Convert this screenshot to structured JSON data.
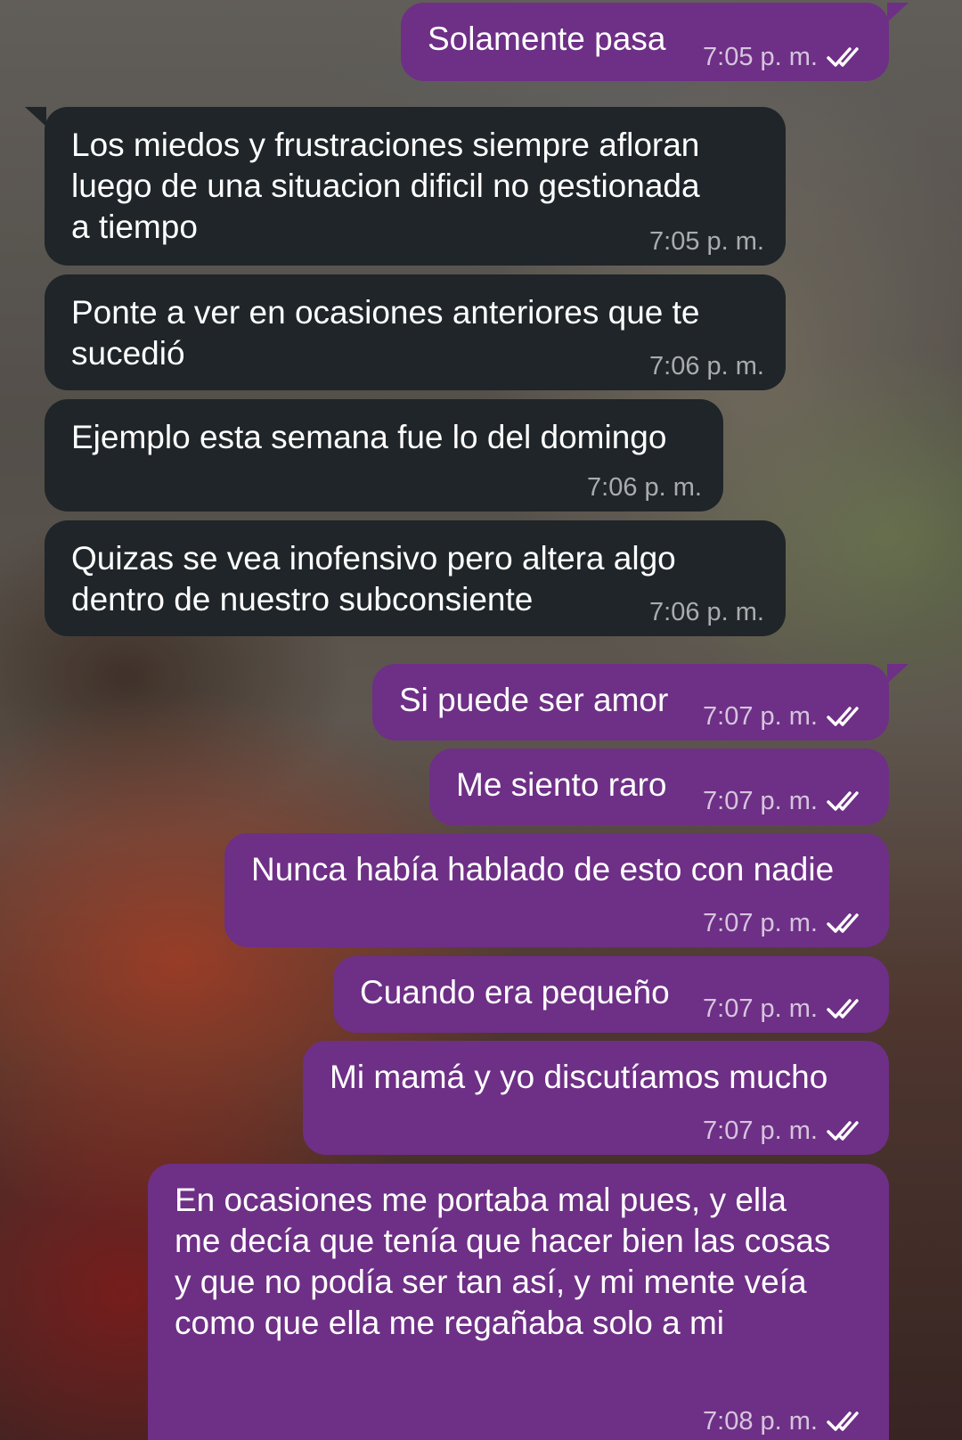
{
  "messages": [
    {
      "direction": "out",
      "text": "Solamente pasa",
      "time": "7:05 p. m.",
      "status_icon": "double-check-icon"
    },
    {
      "direction": "in",
      "text": "Los miedos y frustraciones siempre afloran\nluego de una situacion dificil no gestionada\na tiempo",
      "time": "7:05 p. m."
    },
    {
      "direction": "in",
      "text": "Ponte a ver en ocasiones anteriores que te\nsucedió",
      "time": "7:06 p. m."
    },
    {
      "direction": "in",
      "text": "Ejemplo esta semana fue lo del domingo",
      "time": "7:06 p. m."
    },
    {
      "direction": "in",
      "text": "Quizas se vea inofensivo pero altera algo\ndentro de nuestro subconsiente",
      "time": "7:06 p. m."
    },
    {
      "direction": "out",
      "text": "Si puede ser amor",
      "time": "7:07 p. m.",
      "status_icon": "double-check-icon"
    },
    {
      "direction": "out",
      "text": "Me siento raro",
      "time": "7:07 p. m.",
      "status_icon": "double-check-icon"
    },
    {
      "direction": "out",
      "text": "Nunca había hablado de esto con nadie",
      "time": "7:07 p. m.",
      "status_icon": "double-check-icon"
    },
    {
      "direction": "out",
      "text": "Cuando era pequeño",
      "time": "7:07 p. m.",
      "status_icon": "double-check-icon"
    },
    {
      "direction": "out",
      "text": "Mi mamá y yo discutíamos mucho",
      "time": "7:07 p. m.",
      "status_icon": "double-check-icon"
    },
    {
      "direction": "out",
      "text": "En ocasiones me portaba mal pues, y ella\nme decía que tenía que hacer bien las cosas\ny que no podía ser tan así, y mi mente veía\ncomo que ella me regañaba solo a mi",
      "time": "7:08 p. m.",
      "status_icon": "double-check-icon"
    }
  ],
  "colors": {
    "outgoing_bubble": "#6e2f86",
    "incoming_bubble": "#1f2528"
  }
}
